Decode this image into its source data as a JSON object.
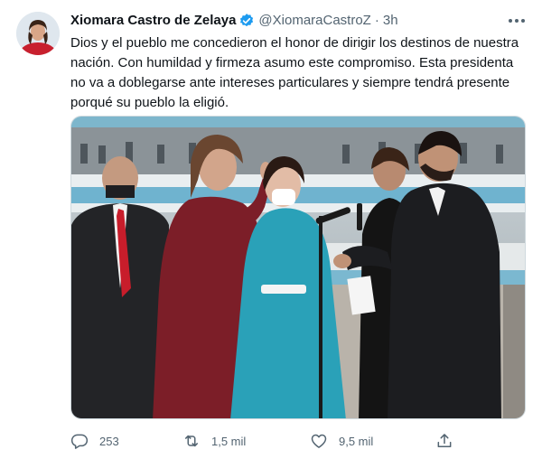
{
  "tweet": {
    "author": {
      "display_name": "Xiomara Castro de Zelaya",
      "handle": "@XiomaraCastroZ",
      "verified_icon": "verified-badge-icon"
    },
    "separator": "·",
    "time": "3h",
    "more_icon": "more-options-icon",
    "text": "Dios y el pueblo me concedieron el honor de dirigir los destinos de nuestra nación. Con humildad y firmeza asumo este compromiso. Esta presidenta no va a doblegarse ante intereses particulares y siempre tendrá presente porqué su pueblo la eligió.",
    "actions": {
      "reply": {
        "icon": "reply-icon",
        "count": "253"
      },
      "retweet": {
        "icon": "retweet-icon",
        "count": "1,5 mil"
      },
      "like": {
        "icon": "like-icon",
        "count": "9,5 mil"
      },
      "share": {
        "icon": "share-icon"
      }
    }
  },
  "colors": {
    "text_primary": "#0f1419",
    "text_secondary": "#536471",
    "verified_blue": "#1d9bf0",
    "border": "#cfd9de"
  }
}
